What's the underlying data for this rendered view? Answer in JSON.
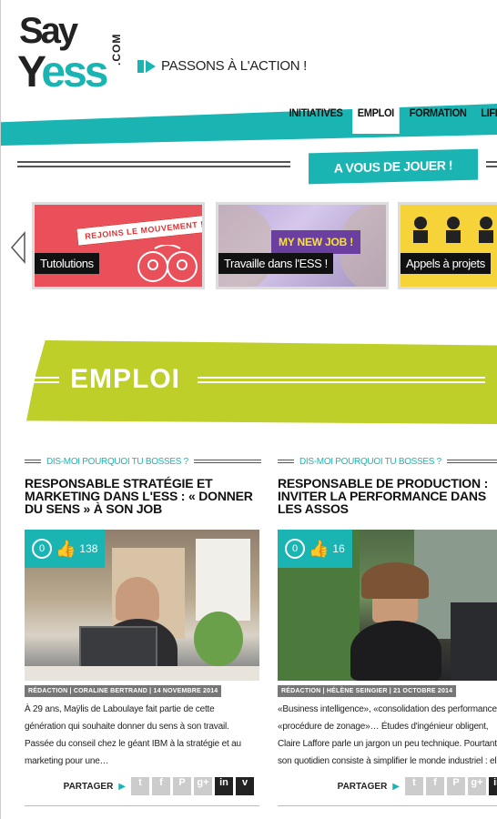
{
  "logo": {
    "line1": "Say",
    "line2a": "Y",
    "line2b": "ess",
    "com": ".COM"
  },
  "tagline": "PASSONS À L'ACTION !",
  "nav": [
    "INITIATIVES",
    "EMPLOI",
    "FORMATION",
    "LIFES"
  ],
  "nav_active": "EMPLOI",
  "avdj": "A VOUS DE JOUER !",
  "carousel": {
    "cards": [
      {
        "label": "Tutolutions",
        "banner": "REJOINS LE MOUVEMENT !"
      },
      {
        "label": "Travaille dans l'ESS !",
        "banner": "MY NEW JOB !"
      },
      {
        "label": "Appels à projets"
      }
    ]
  },
  "section_title": "EMPLOI",
  "articles": [
    {
      "kicker": "DIS-MOI POURQUOI TU BOSSES ?",
      "title": "RESPONSABLE STRATÉGIE ET MARKETING DANS L'ESS : « DONNER DU SENS » À SON JOB",
      "comments": "0",
      "likes": "138",
      "byline": "RÉDACTION | CORALINE BERTRAND | 14 NOVEMBRE 2014",
      "excerpt": "À 29 ans, Maÿlis de Laboulaye fait partie de cette génération qui souhaite donner du sens à son travail. Passée du conseil chez le géant IBM à la stratégie et au marketing pour une…",
      "share_label": "PARTAGER"
    },
    {
      "kicker": "DIS-MOI POURQUOI TU BOSSES ?",
      "title": "RESPONSABLE DE PRODUCTION : INVITER LA PERFORMANCE DANS LES ASSOS",
      "comments": "0",
      "likes": "16",
      "byline": "RÉDACTION | HÉLÈNE SEINGIER | 21 OCTOBRE 2014",
      "excerpt": "«Business intelligence», «consolidation des performances», «procédure de zonage»… Études d'ingénieur obligent, Claire Laffore parle un jargon un peu technique. Pourtant son quotidien consiste à simplifier le monde industriel : elle supervise la production d'une…",
      "share_label": "PARTAGER"
    }
  ],
  "share_icons": [
    "twitter-icon",
    "facebook-icon",
    "pinterest-icon",
    "googleplus-icon",
    "linkedin-icon",
    "viadeo-icon"
  ],
  "colors": {
    "teal": "#1ab5b3",
    "lime": "#bfcf2a",
    "red": "#e9505a",
    "yellow": "#f7d33a"
  }
}
